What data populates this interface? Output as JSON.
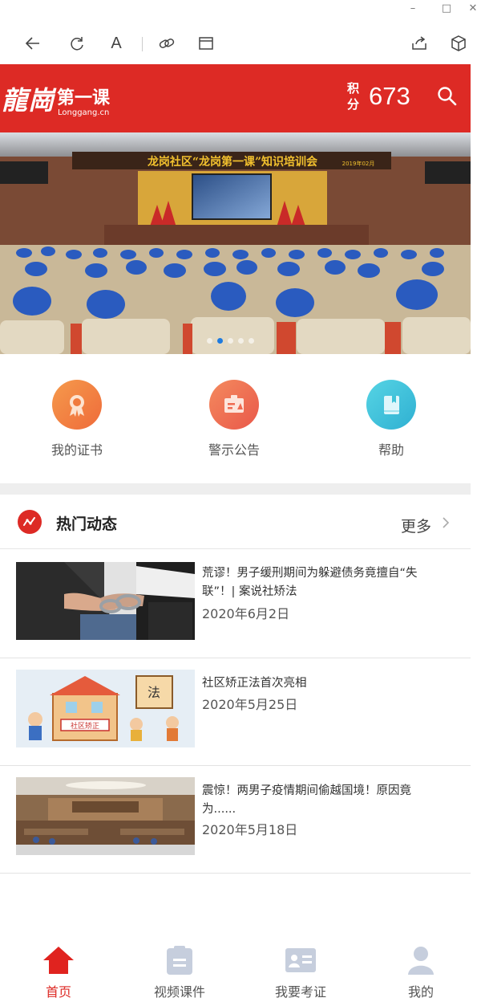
{
  "window": {
    "minimize": "–",
    "maximize": "□",
    "close": "✕"
  },
  "toolbar": {
    "font_label": "A"
  },
  "header": {
    "logo_script": "龍崗",
    "logo_name": "第一课",
    "logo_sub": "Longgang.cn",
    "points_label": "积分",
    "points_value": "673",
    "brand_color": "#dd2a25"
  },
  "banner": {
    "sign_text": "龙岗社区“龙岗第一课”知识培训会",
    "sign_date": "2019年02月",
    "slides": 5,
    "active_slide": 1
  },
  "quickmenu": [
    {
      "label": "我的证书",
      "icon": "certificate-icon",
      "color": "#f07a3c"
    },
    {
      "label": "警示公告",
      "icon": "notice-icon",
      "color": "#ef6a50"
    },
    {
      "label": "帮助",
      "icon": "help-book-icon",
      "color": "#3fc3d8"
    }
  ],
  "section": {
    "title": "热门动态",
    "more": "更多"
  },
  "news": [
    {
      "title": "荒谬！男子缓刑期间为躲避债务竟擅自“失联”！| 案说社矫法",
      "date": "2020年6月2日"
    },
    {
      "title": "社区矫正法首次亮相",
      "date": "2020年5月25日"
    },
    {
      "title": "震惊！两男子疫情期间偷越国境！原因竟为......",
      "date": "2020年5月18日"
    }
  ],
  "thumb_labels": {
    "cartoon_sign": "社区矫正",
    "cartoon_law": "法"
  },
  "bottomnav": [
    {
      "label": "首页",
      "icon": "home-icon",
      "active": true
    },
    {
      "label": "视频课件",
      "icon": "video-course-icon",
      "active": false
    },
    {
      "label": "我要考证",
      "icon": "id-card-icon",
      "active": false
    },
    {
      "label": "我的",
      "icon": "user-icon",
      "active": false
    }
  ]
}
